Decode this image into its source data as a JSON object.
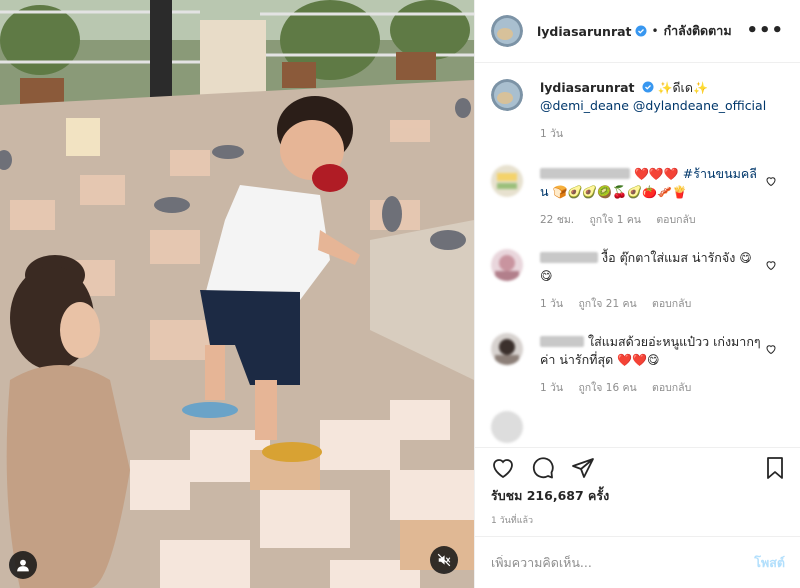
{
  "post": {
    "username": "lydiasarunrat",
    "follow_status": "กำลังติดตาม",
    "more_label": "•••"
  },
  "caption": {
    "username": "lydiasarunrat",
    "text": "ดีเด",
    "mentions": [
      "@demi_deane",
      "@dylandeane_official"
    ],
    "time": "1 วัน"
  },
  "comments": [
    {
      "text_prefix": "",
      "hashtag": "#ร้านขนมคลีน",
      "emojis_line1": "❤️❤️❤️",
      "emojis_line2": "🍞🥑🥑🥝🍒🥑🍅🥓🍟",
      "time": "22 ชม.",
      "likes": "ถูกใจ 1 คน",
      "reply": "ตอบกลับ"
    },
    {
      "text": "งื้อ ตุ๊กตาใส่แมส น่ารักจัง",
      "emojis": "😋😋",
      "time": "1 วัน",
      "likes": "ถูกใจ 21 คน",
      "reply": "ตอบกลับ"
    },
    {
      "text": "ใส่แมสด้วยอ่ะหนูแป๋วว เก่งมากๆค่า น่ารักที่สุด",
      "emojis": "❤️❤️😋",
      "time": "1 วัน",
      "likes": "ถูกใจ 16 คน",
      "reply": "ตอบกลับ"
    }
  ],
  "stats": {
    "views": "รับชม 216,687 ครั้ง",
    "posted": "1 วันที่แล้ว"
  },
  "add_comment": {
    "placeholder": "เพิ่มความคิดเห็น...",
    "post_label": "โพสต์"
  },
  "icons": {
    "like": "heart-icon",
    "comment": "comment-icon",
    "share": "share-icon",
    "save": "bookmark-icon",
    "mute": "speaker-muted-icon",
    "user_tag": "user-tag-icon",
    "verified": "verified-badge-icon"
  },
  "colors": {
    "link": "#00376b",
    "post_button": "#b2dffc",
    "muted_text": "#8e8e8e",
    "verified": "#3897f0"
  }
}
